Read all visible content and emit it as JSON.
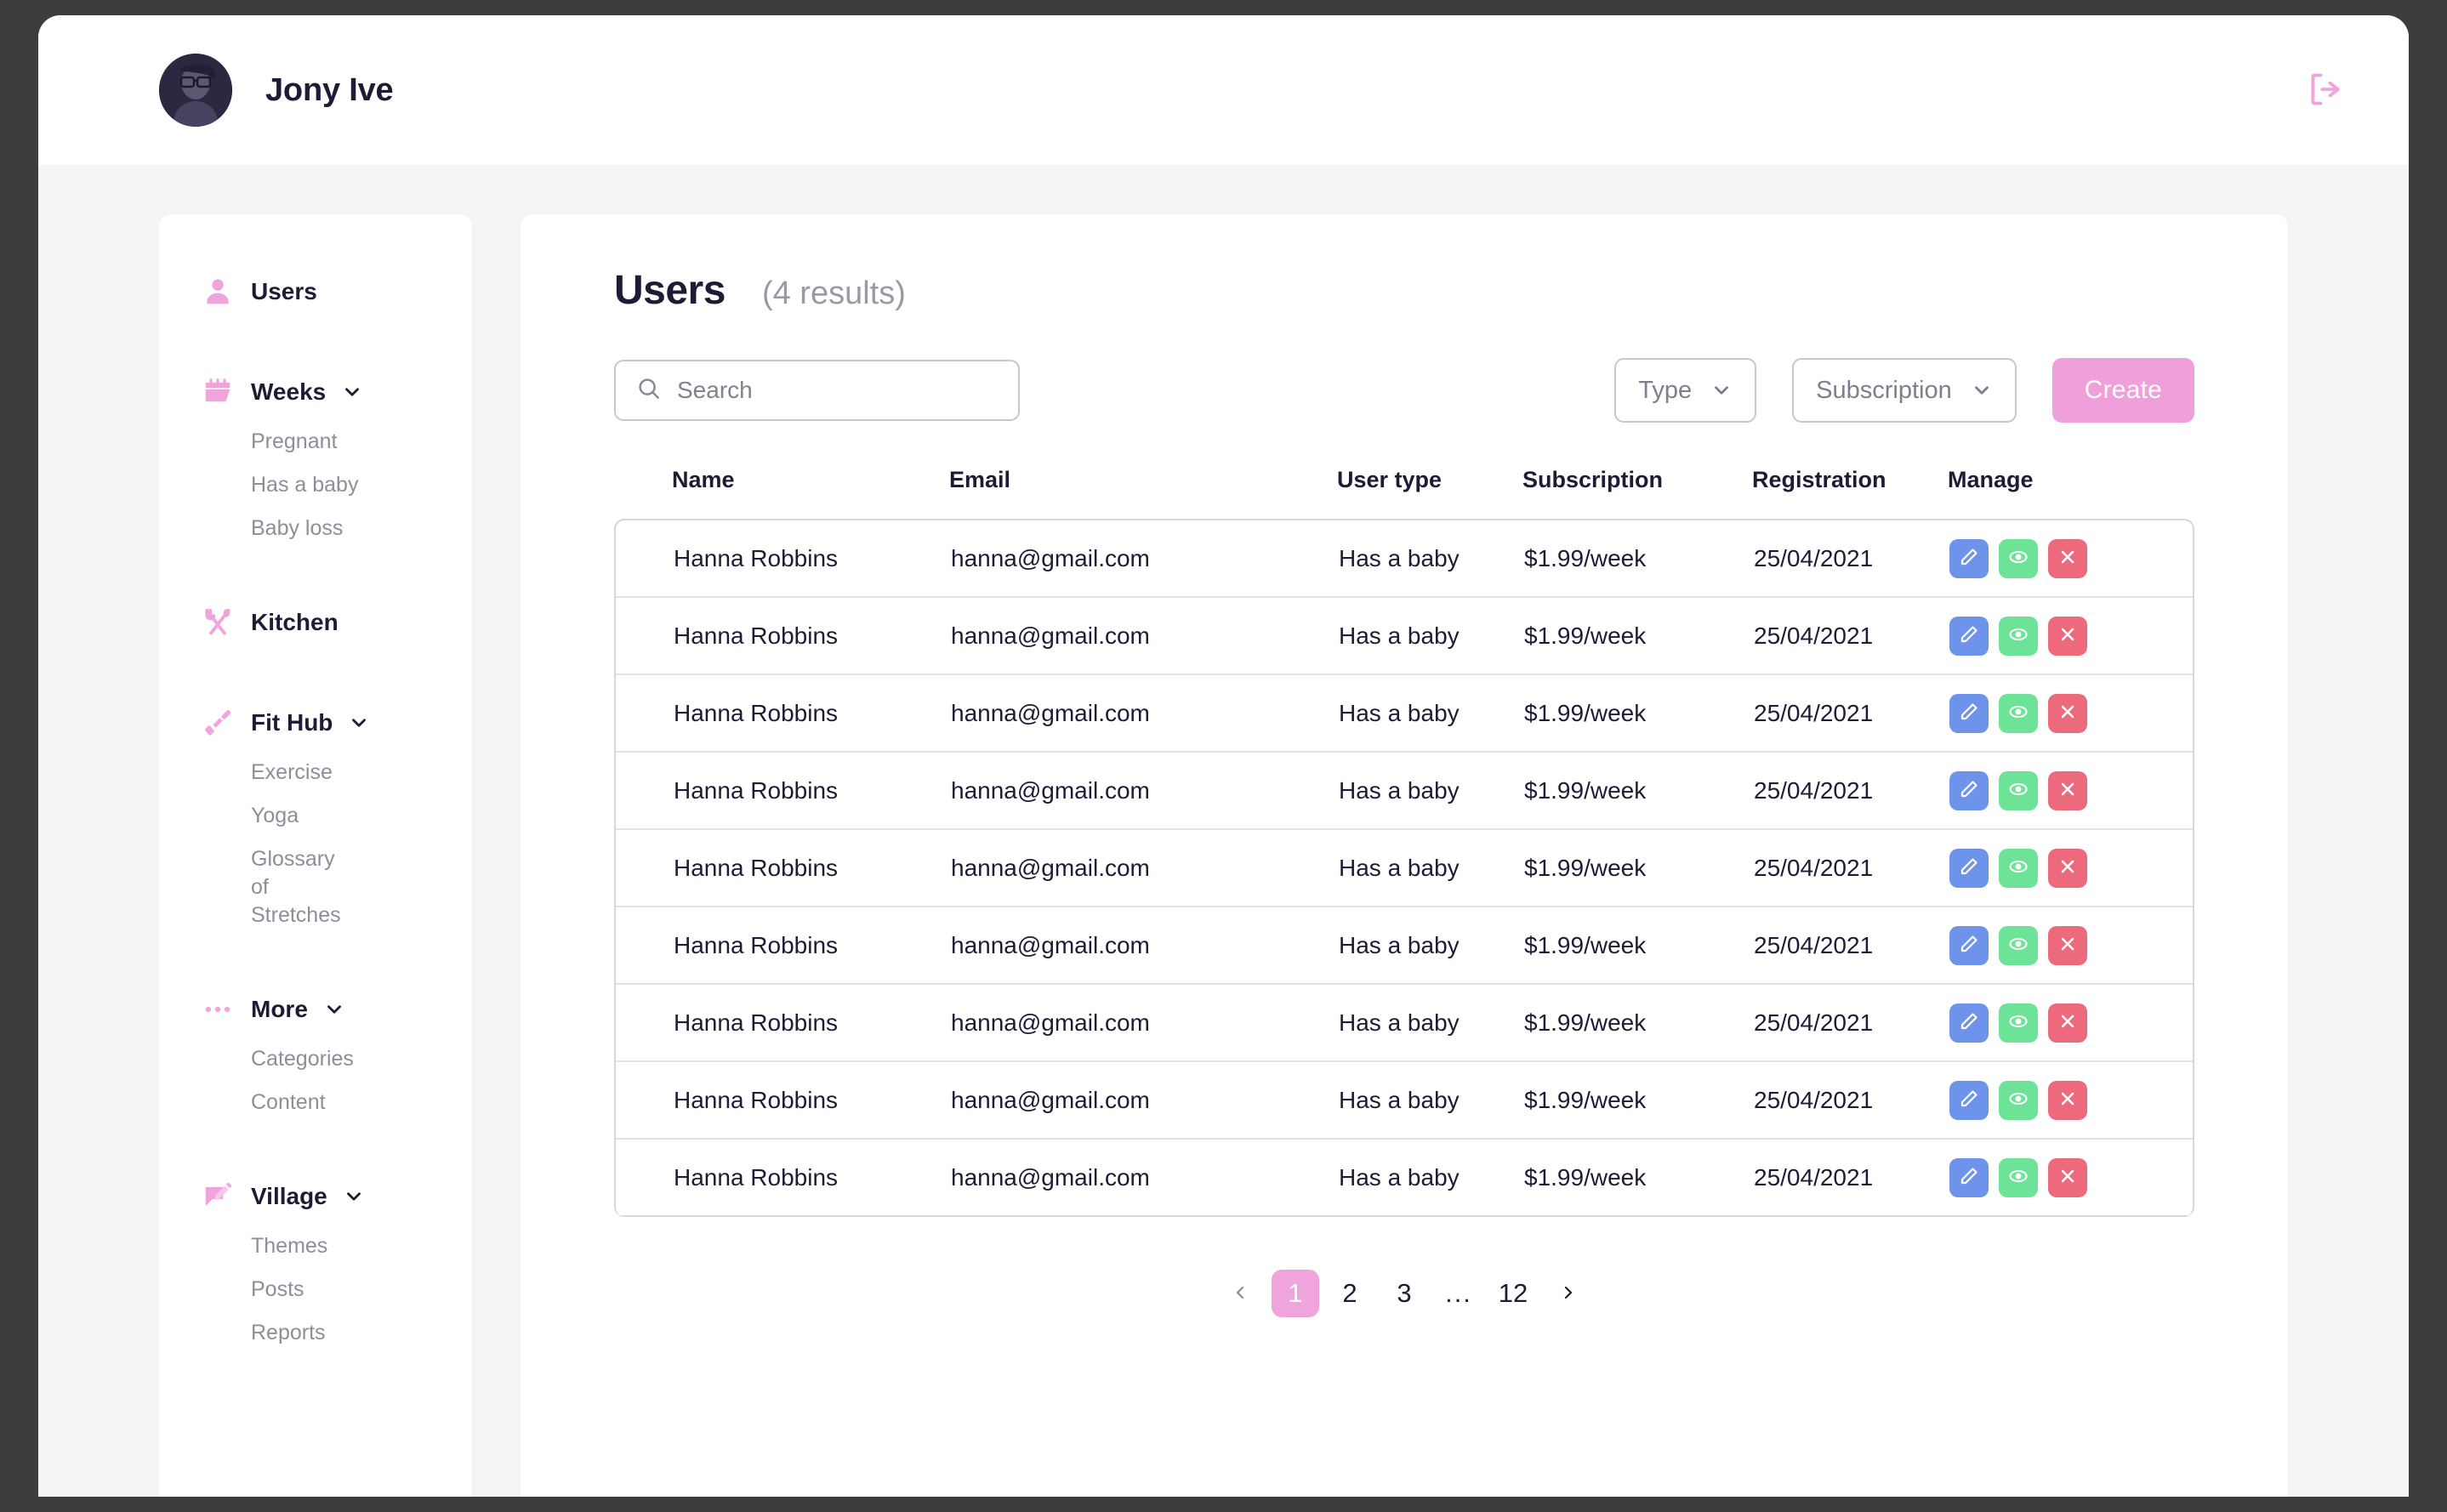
{
  "header": {
    "user_name": "Jony Ive",
    "avatar_name": "user-avatar",
    "logout_icon": "logout-icon"
  },
  "sidebar": {
    "groups": [
      {
        "label": "Users",
        "icon": "person-icon",
        "expandable": false,
        "items": []
      },
      {
        "label": "Weeks",
        "icon": "calendar-icon",
        "expandable": true,
        "items": [
          "Pregnant",
          "Has a baby",
          "Baby loss"
        ]
      },
      {
        "label": "Kitchen",
        "icon": "fork-spoon-icon",
        "expandable": false,
        "items": []
      },
      {
        "label": "Fit Hub",
        "icon": "dumbbell-icon",
        "expandable": true,
        "items": [
          "Exercise",
          "Yoga",
          "Glossary of Stretches"
        ]
      },
      {
        "label": "More",
        "icon": "ellipsis-icon",
        "expandable": true,
        "items": [
          "Categories",
          "Content"
        ]
      },
      {
        "label": "Village",
        "icon": "chat-pencil-icon",
        "expandable": true,
        "items": [
          "Themes",
          "Posts",
          "Reports"
        ]
      }
    ]
  },
  "main": {
    "title": "Users",
    "results": "(4 results)",
    "search": {
      "placeholder": "Search",
      "value": "",
      "icon": "search-icon"
    },
    "filters": [
      {
        "label": "Type",
        "icon": "chevron-down-icon"
      },
      {
        "label": "Subscription",
        "icon": "chevron-down-icon"
      }
    ],
    "create_label": "Create",
    "table": {
      "columns": [
        "Name",
        "Email",
        "User type",
        "Subscription",
        "Registration",
        "Manage"
      ],
      "actions": [
        {
          "name": "edit-button",
          "icon": "pencil-icon",
          "color": "#6d93eb"
        },
        {
          "name": "view-button",
          "icon": "eye-icon",
          "color": "#6ce396"
        },
        {
          "name": "delete-button",
          "icon": "close-icon",
          "color": "#ec6a7c"
        }
      ],
      "rows": [
        {
          "name": "Hanna Robbins",
          "email": "hanna@gmail.com",
          "user_type": "Has a baby",
          "subscription": "$1.99/week",
          "registration": "25/04/2021"
        },
        {
          "name": "Hanna Robbins",
          "email": "hanna@gmail.com",
          "user_type": "Has a baby",
          "subscription": "$1.99/week",
          "registration": "25/04/2021"
        },
        {
          "name": "Hanna Robbins",
          "email": "hanna@gmail.com",
          "user_type": "Has a baby",
          "subscription": "$1.99/week",
          "registration": "25/04/2021"
        },
        {
          "name": "Hanna Robbins",
          "email": "hanna@gmail.com",
          "user_type": "Has a baby",
          "subscription": "$1.99/week",
          "registration": "25/04/2021"
        },
        {
          "name": "Hanna Robbins",
          "email": "hanna@gmail.com",
          "user_type": "Has a baby",
          "subscription": "$1.99/week",
          "registration": "25/04/2021"
        },
        {
          "name": "Hanna Robbins",
          "email": "hanna@gmail.com",
          "user_type": "Has a baby",
          "subscription": "$1.99/week",
          "registration": "25/04/2021"
        },
        {
          "name": "Hanna Robbins",
          "email": "hanna@gmail.com",
          "user_type": "Has a baby",
          "subscription": "$1.99/week",
          "registration": "25/04/2021"
        },
        {
          "name": "Hanna Robbins",
          "email": "hanna@gmail.com",
          "user_type": "Has a baby",
          "subscription": "$1.99/week",
          "registration": "25/04/2021"
        },
        {
          "name": "Hanna Robbins",
          "email": "hanna@gmail.com",
          "user_type": "Has a baby",
          "subscription": "$1.99/week",
          "registration": "25/04/2021"
        }
      ]
    },
    "pagination": {
      "prev_icon": "chevron-left-icon",
      "next_icon": "chevron-right-icon",
      "pages": [
        "1",
        "2",
        "3",
        "...",
        "12"
      ],
      "active_page": "1"
    }
  },
  "colors": {
    "accent_pink": "#efa0da",
    "icon_pink": "#f0a4dc",
    "text_dark": "#1e1b36",
    "text_muted": "#8e8e9b",
    "edit_blue": "#6d93eb",
    "view_green": "#6ce396",
    "delete_red": "#ec6a7c",
    "page_bg": "#f5f5f6",
    "frame": "#3d3d3d"
  }
}
